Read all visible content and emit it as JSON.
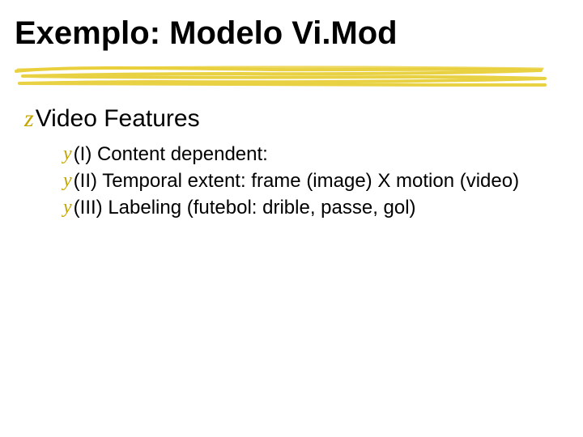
{
  "title": "Exemplo: Modelo Vi.Mod",
  "section": {
    "bullet": "z",
    "label": "Video Features",
    "items": [
      {
        "bullet": "y",
        "text": " (I) Content dependent:"
      },
      {
        "bullet": "y",
        "text": " (II) Temporal extent: frame (image) X motion (video)"
      },
      {
        "bullet": "y",
        "text": "(III) Labeling (futebol: drible, passe, gol)"
      }
    ]
  },
  "colors": {
    "accent": "#c2a500"
  }
}
